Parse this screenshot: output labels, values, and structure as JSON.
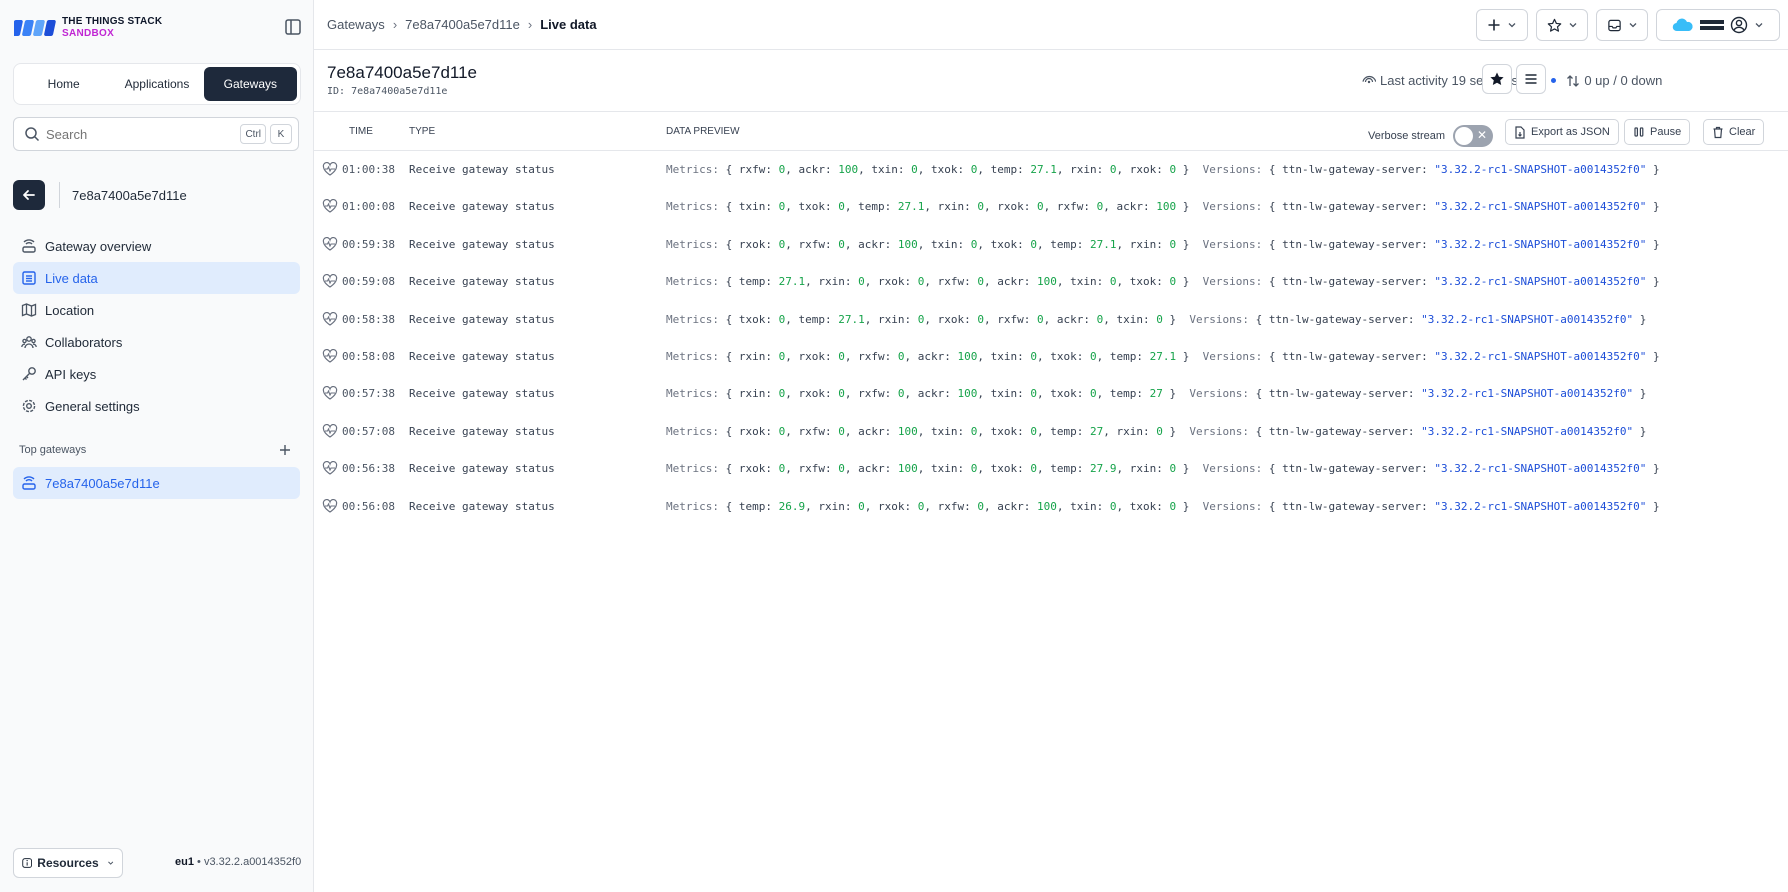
{
  "brand": {
    "line1": "THE THINGS STACK",
    "line2": "SANDBOX"
  },
  "nav": {
    "home": "Home",
    "applications": "Applications",
    "gateways": "Gateways"
  },
  "search": {
    "placeholder": "Search",
    "kbd1": "Ctrl",
    "kbd2": "K"
  },
  "entity": {
    "title": "7e8a7400a5e7d11e"
  },
  "menu": {
    "overview": "Gateway overview",
    "live": "Live data",
    "location": "Location",
    "collaborators": "Collaborators",
    "api_keys": "API keys",
    "settings": "General settings"
  },
  "top_gateways": {
    "heading": "Top gateways",
    "item": "7e8a7400a5e7d11e"
  },
  "footer": {
    "resources": "Resources",
    "region": "eu1",
    "version": "v3.32.2.a0014352f0"
  },
  "breadcrumbs": {
    "c1": "Gateways",
    "c2": "7e8a7400a5e7d11e",
    "c3": "Live data"
  },
  "header": {
    "title": "7e8a7400a5e7d11e",
    "id_label": "ID:",
    "id_value": "7e8a7400a5e7d11e",
    "last_activity": "Last activity 19 seconds ago",
    "traffic": "0 up / 0 down"
  },
  "table": {
    "col_time": "TIME",
    "col_type": "TYPE",
    "col_preview": "DATA PREVIEW",
    "verbose_label": "Verbose stream",
    "export_label": "Export as JSON",
    "pause_label": "Pause",
    "clear_label": "Clear"
  },
  "events": [
    {
      "time": "01:00:38",
      "type": "Receive gateway status",
      "metrics": [
        [
          "rxfw",
          "0"
        ],
        [
          "ackr",
          "100"
        ],
        [
          "txin",
          "0"
        ],
        [
          "txok",
          "0"
        ],
        [
          "temp",
          "27.1"
        ],
        [
          "rxin",
          "0"
        ],
        [
          "rxok",
          "0"
        ]
      ],
      "server": "ttn-lw-gateway-server",
      "version": "\"3.32.2-rc1-SNAPSHOT-a0014352f0\""
    },
    {
      "time": "01:00:08",
      "type": "Receive gateway status",
      "metrics": [
        [
          "txin",
          "0"
        ],
        [
          "txok",
          "0"
        ],
        [
          "temp",
          "27.1"
        ],
        [
          "rxin",
          "0"
        ],
        [
          "rxok",
          "0"
        ],
        [
          "rxfw",
          "0"
        ],
        [
          "ackr",
          "100"
        ]
      ],
      "server": "ttn-lw-gateway-server",
      "version": "\"3.32.2-rc1-SNAPSHOT-a0014352f0\""
    },
    {
      "time": "00:59:38",
      "type": "Receive gateway status",
      "metrics": [
        [
          "rxok",
          "0"
        ],
        [
          "rxfw",
          "0"
        ],
        [
          "ackr",
          "100"
        ],
        [
          "txin",
          "0"
        ],
        [
          "txok",
          "0"
        ],
        [
          "temp",
          "27.1"
        ],
        [
          "rxin",
          "0"
        ]
      ],
      "server": "ttn-lw-gateway-server",
      "version": "\"3.32.2-rc1-SNAPSHOT-a0014352f0\""
    },
    {
      "time": "00:59:08",
      "type": "Receive gateway status",
      "metrics": [
        [
          "temp",
          "27.1"
        ],
        [
          "rxin",
          "0"
        ],
        [
          "rxok",
          "0"
        ],
        [
          "rxfw",
          "0"
        ],
        [
          "ackr",
          "100"
        ],
        [
          "txin",
          "0"
        ],
        [
          "txok",
          "0"
        ]
      ],
      "server": "ttn-lw-gateway-server",
      "version": "\"3.32.2-rc1-SNAPSHOT-a0014352f0\""
    },
    {
      "time": "00:58:38",
      "type": "Receive gateway status",
      "metrics": [
        [
          "txok",
          "0"
        ],
        [
          "temp",
          "27.1"
        ],
        [
          "rxin",
          "0"
        ],
        [
          "rxok",
          "0"
        ],
        [
          "rxfw",
          "0"
        ],
        [
          "ackr",
          "0"
        ],
        [
          "txin",
          "0"
        ]
      ],
      "server": "ttn-lw-gateway-server",
      "version": "\"3.32.2-rc1-SNAPSHOT-a0014352f0\""
    },
    {
      "time": "00:58:08",
      "type": "Receive gateway status",
      "metrics": [
        [
          "rxin",
          "0"
        ],
        [
          "rxok",
          "0"
        ],
        [
          "rxfw",
          "0"
        ],
        [
          "ackr",
          "100"
        ],
        [
          "txin",
          "0"
        ],
        [
          "txok",
          "0"
        ],
        [
          "temp",
          "27.1"
        ]
      ],
      "server": "ttn-lw-gateway-server",
      "version": "\"3.32.2-rc1-SNAPSHOT-a0014352f0\""
    },
    {
      "time": "00:57:38",
      "type": "Receive gateway status",
      "metrics": [
        [
          "rxin",
          "0"
        ],
        [
          "rxok",
          "0"
        ],
        [
          "rxfw",
          "0"
        ],
        [
          "ackr",
          "100"
        ],
        [
          "txin",
          "0"
        ],
        [
          "txok",
          "0"
        ],
        [
          "temp",
          "27"
        ]
      ],
      "server": "ttn-lw-gateway-server",
      "version": "\"3.32.2-rc1-SNAPSHOT-a0014352f0\""
    },
    {
      "time": "00:57:08",
      "type": "Receive gateway status",
      "metrics": [
        [
          "rxok",
          "0"
        ],
        [
          "rxfw",
          "0"
        ],
        [
          "ackr",
          "100"
        ],
        [
          "txin",
          "0"
        ],
        [
          "txok",
          "0"
        ],
        [
          "temp",
          "27"
        ],
        [
          "rxin",
          "0"
        ]
      ],
      "server": "ttn-lw-gateway-server",
      "version": "\"3.32.2-rc1-SNAPSHOT-a0014352f0\""
    },
    {
      "time": "00:56:38",
      "type": "Receive gateway status",
      "metrics": [
        [
          "rxok",
          "0"
        ],
        [
          "rxfw",
          "0"
        ],
        [
          "ackr",
          "100"
        ],
        [
          "txin",
          "0"
        ],
        [
          "txok",
          "0"
        ],
        [
          "temp",
          "27.9"
        ],
        [
          "rxin",
          "0"
        ]
      ],
      "server": "ttn-lw-gateway-server",
      "version": "\"3.32.2-rc1-SNAPSHOT-a0014352f0\""
    },
    {
      "time": "00:56:08",
      "type": "Receive gateway status",
      "metrics": [
        [
          "temp",
          "26.9"
        ],
        [
          "rxin",
          "0"
        ],
        [
          "rxok",
          "0"
        ],
        [
          "rxfw",
          "0"
        ],
        [
          "ackr",
          "100"
        ],
        [
          "txin",
          "0"
        ],
        [
          "txok",
          "0"
        ]
      ],
      "server": "ttn-lw-gateway-server",
      "version": "\"3.32.2-rc1-SNAPSHOT-a0014352f0\""
    }
  ],
  "labels": {
    "metrics": "Metrics:",
    "versions": "Versions:"
  },
  "colors": {
    "accent": "#2563eb",
    "dark": "#1e293b",
    "brand_magenta": "#c026d3",
    "number": "#16a34a",
    "string": "#1d4ed8"
  }
}
